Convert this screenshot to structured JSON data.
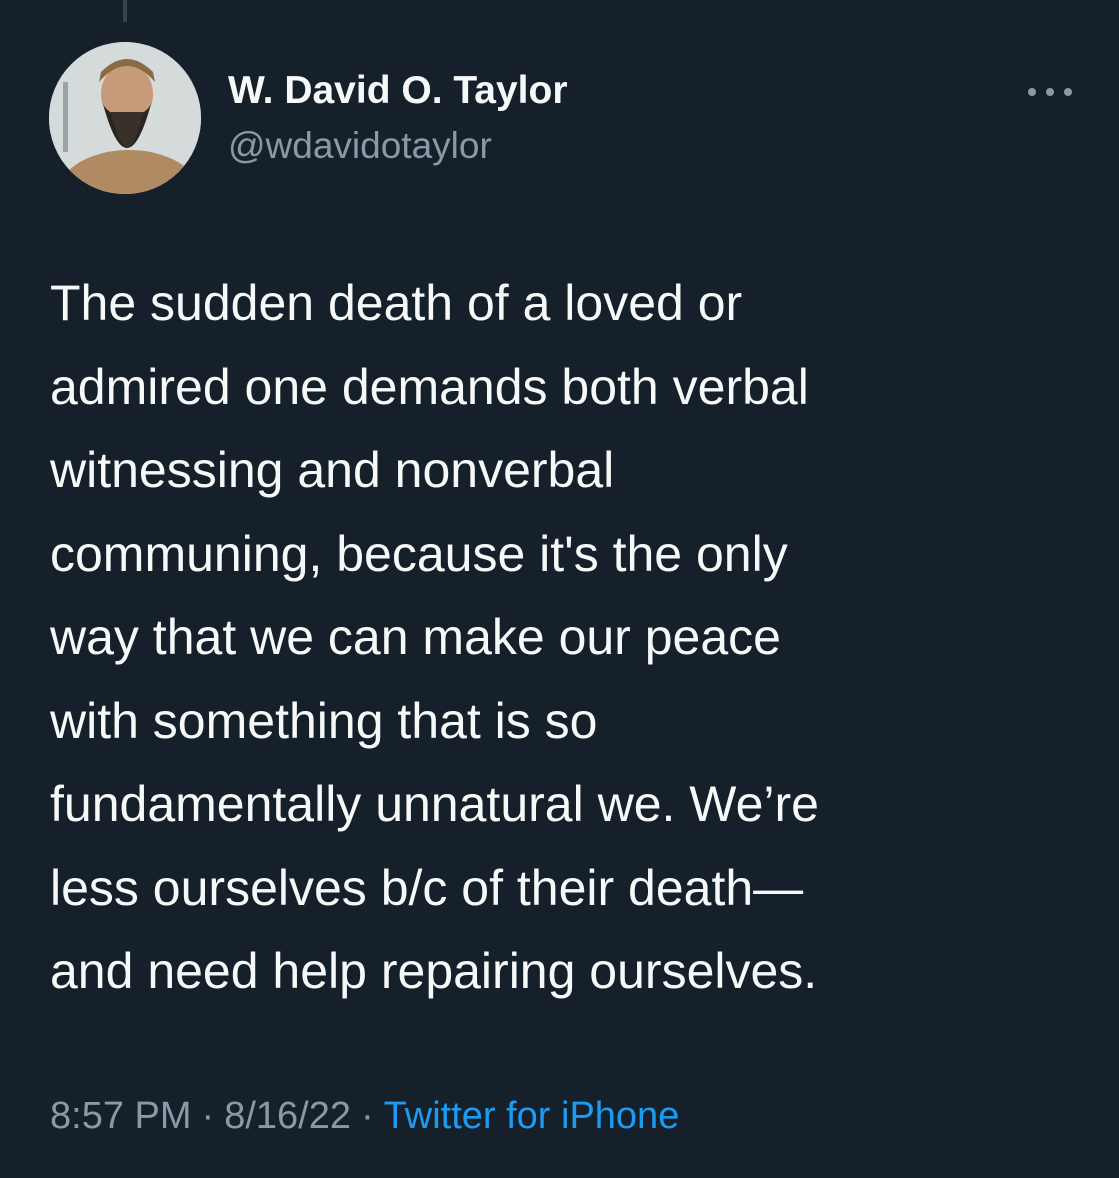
{
  "author": {
    "display_name": "W. David O. Taylor",
    "handle": "@wdavidotaylor"
  },
  "tweet": {
    "lines": [
      "The sudden death of a loved or",
      "admired one demands both verbal",
      "witnessing and nonverbal",
      "communing, because it's the only",
      "way that we can make our peace",
      "with something that is so",
      "fundamentally unnatural we. We’re",
      "less ourselves b/c of their death—",
      "and need help repairing ourselves."
    ]
  },
  "meta": {
    "time": "8:57 PM",
    "date": "8/16/22",
    "separator": "·",
    "source": "Twitter for iPhone"
  },
  "icons": {
    "more": "more-horizontal-icon",
    "avatar": "avatar"
  },
  "colors": {
    "background": "#15202b",
    "primary_text": "#f7f9f9",
    "secondary_text": "#8b98a5",
    "link": "#1d9bf0"
  }
}
